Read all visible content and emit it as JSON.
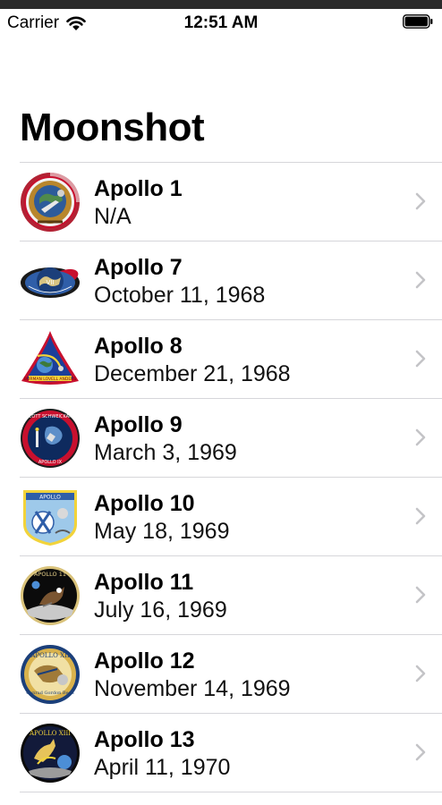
{
  "status": {
    "carrier": "Carrier",
    "time": "12:51 AM"
  },
  "nav": {
    "title": "Moonshot"
  },
  "missions": [
    {
      "name": "Apollo 1",
      "date": "N/A",
      "icon": "apollo-1-patch-icon"
    },
    {
      "name": "Apollo 7",
      "date": "October 11, 1968",
      "icon": "apollo-7-patch-icon"
    },
    {
      "name": "Apollo 8",
      "date": "December 21, 1968",
      "icon": "apollo-8-patch-icon"
    },
    {
      "name": "Apollo 9",
      "date": "March 3, 1969",
      "icon": "apollo-9-patch-icon"
    },
    {
      "name": "Apollo 10",
      "date": "May 18, 1969",
      "icon": "apollo-10-patch-icon"
    },
    {
      "name": "Apollo 11",
      "date": "July 16, 1969",
      "icon": "apollo-11-patch-icon"
    },
    {
      "name": "Apollo 12",
      "date": "November 14, 1969",
      "icon": "apollo-12-patch-icon"
    },
    {
      "name": "Apollo 13",
      "date": "April 11, 1970",
      "icon": "apollo-13-patch-icon"
    }
  ],
  "colors": {
    "separator": "#d6d6da",
    "chevron": "#c4c4c7"
  }
}
